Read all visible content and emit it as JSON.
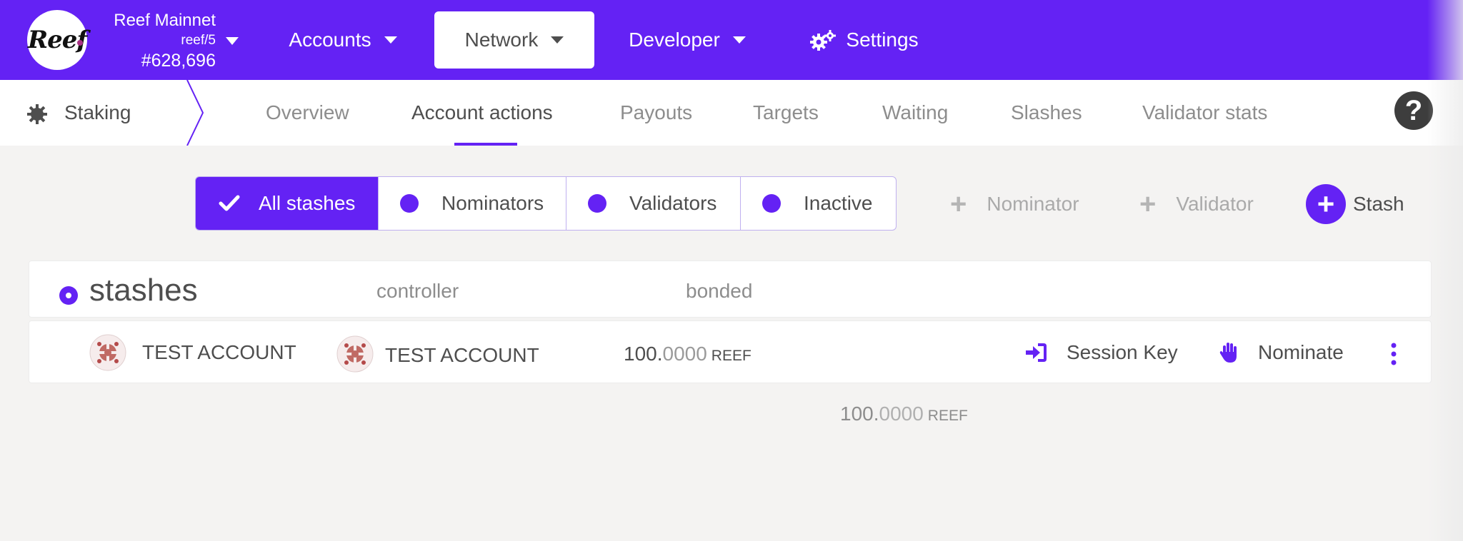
{
  "colors": {
    "brand": "#6422f4",
    "background": "#f4f3f2"
  },
  "header": {
    "logo_text": "Reef",
    "chain_name": "Reef Mainnet",
    "chain_spec": "reef/5",
    "block_number": "#628,696",
    "menu": [
      {
        "label": "Accounts",
        "icon": "caret-down-icon"
      },
      {
        "label": "Network",
        "icon": "caret-down-icon",
        "active": true
      },
      {
        "label": "Developer",
        "icon": "caret-down-icon"
      },
      {
        "label": "Settings",
        "icon": "gears-icon"
      }
    ]
  },
  "subnav": {
    "section": "Staking",
    "tabs": [
      "Overview",
      "Account actions",
      "Payouts",
      "Targets",
      "Waiting",
      "Slashes",
      "Validator stats"
    ],
    "active_tab": "Account actions",
    "help": "?"
  },
  "filters": [
    {
      "label": "All stashes",
      "active": true
    },
    {
      "label": "Nominators"
    },
    {
      "label": "Validators"
    },
    {
      "label": "Inactive"
    }
  ],
  "actions": {
    "add_nominator": "Nominator",
    "add_validator": "Validator",
    "add_stash": "Stash",
    "plus": "+"
  },
  "table": {
    "title": "stashes",
    "columns": {
      "controller": "controller",
      "bonded": "bonded"
    },
    "rows": [
      {
        "stash": "TEST ACCOUNT",
        "controller": "TEST ACCOUNT",
        "bonded_int": "100.",
        "bonded_dec": "0000",
        "unit": "REEF",
        "session_key": "Session Key",
        "nominate": "Nominate"
      }
    ],
    "total_int": "100.",
    "total_dec": "0000",
    "total_unit": "REEF"
  }
}
